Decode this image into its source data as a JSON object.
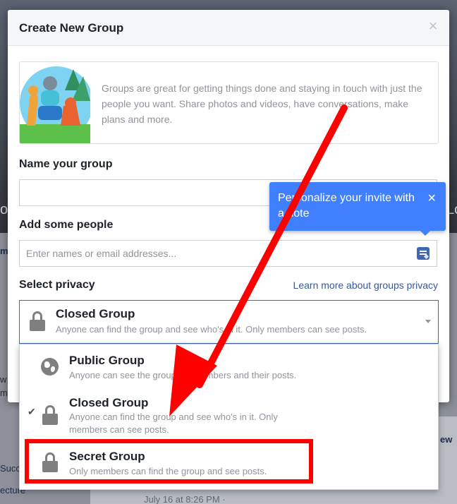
{
  "background": {
    "left_fragments": [
      "og",
      "m",
      "w",
      "mu",
      "Succ",
      "ecture"
    ],
    "right_fragment": "Lo",
    "view_link": "ew",
    "post_time": "July 16 at 8:26 PM · "
  },
  "dialog": {
    "title": "Create New Group",
    "close_icon": "close-icon",
    "intro_text": "Groups are great for getting things done and staying in touch with just the people you want. Share photos and videos, have conversations, make plans and more.",
    "name_label": "Name your group",
    "name_value": "",
    "people_label": "Add some people",
    "people_placeholder": "Enter names or email addresses...",
    "privacy_label": "Select privacy",
    "learn_more": "Learn more about groups privacy",
    "selected": {
      "title": "Closed Group",
      "description": "Anyone can find the group and see who's in it. Only members can see posts."
    }
  },
  "tooltip": {
    "text": "Personalize your invite with a note",
    "close": "×"
  },
  "privacy_options": [
    {
      "title": "Public Group",
      "description": "Anyone can see the group, its members and their posts.",
      "icon": "globe-icon",
      "checked": false
    },
    {
      "title": "Closed Group",
      "description": "Anyone can find the group and see who's in it. Only members can see posts.",
      "icon": "lock-icon",
      "checked": true
    },
    {
      "title": "Secret Group",
      "description": "Only members can find the group and see posts.",
      "icon": "lock-icon",
      "checked": false
    }
  ],
  "check_mark": "✔",
  "colors": {
    "accent": "#4267b2",
    "tooltip": "#4080ff",
    "annotation": "#ff0000"
  }
}
